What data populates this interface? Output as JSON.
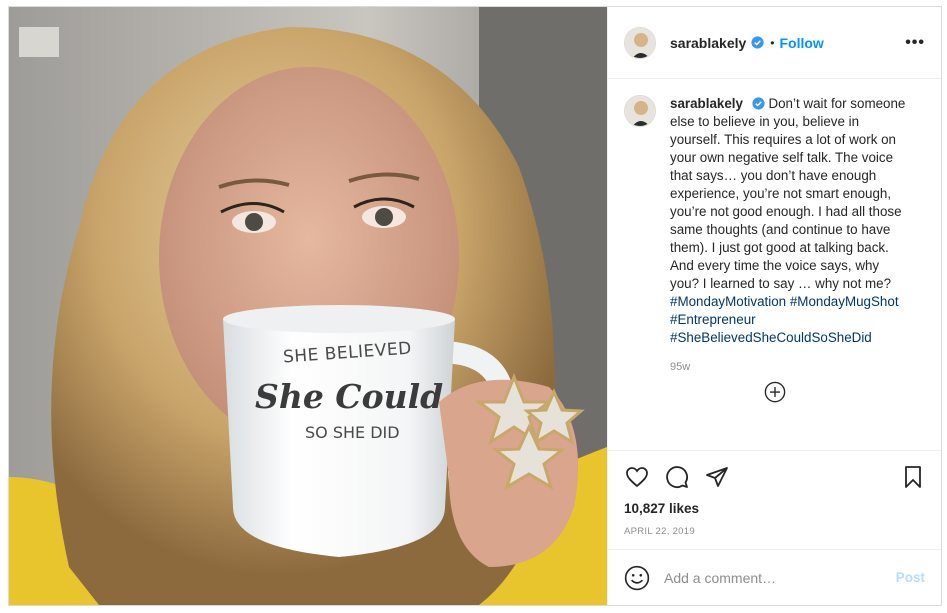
{
  "post": {
    "username": "sarablakely",
    "separator": "•",
    "follow_label": "Follow",
    "more_label": "•••",
    "caption_user": "sarablakely",
    "caption_text": "Don’t wait for someone else to believe in you, believe in yourself. This requires a lot of work on your own negative self talk. The voice that says… you don’t have enough experience, you’re not smart enough, you’re not good enough. I had all those same thoughts (and continue to have them). I just got good at talking back. And every time the voice says, why you? I learned to say … why not me?",
    "hashtags": [
      "#MondayMotivation",
      "#MondayMugShot",
      "#Entrepreneur",
      "#SheBelievedSheCouldSoSheDid"
    ],
    "caption_age": "95w",
    "likes": "10,827 likes",
    "date": "APRIL 22, 2019"
  },
  "mug": {
    "line1": "SHE BELIEVED",
    "line2": "She Could",
    "line3": "SO SHE DID"
  },
  "comment": {
    "placeholder": "Add a comment…",
    "post_label": "Post"
  },
  "icons": {
    "verified": "verified-badge-icon",
    "more": "more-options-icon",
    "like": "heart-icon",
    "comment": "comment-bubble-icon",
    "share": "paper-plane-icon",
    "save": "bookmark-icon",
    "load_more": "plus-circle-icon",
    "emoji": "smiley-icon"
  },
  "colors": {
    "accent": "#0095f6",
    "hashtag": "#00376b",
    "muted": "#8e8e8e",
    "post_disabled": "#b2dffc",
    "sweater": "#e9c52d"
  }
}
